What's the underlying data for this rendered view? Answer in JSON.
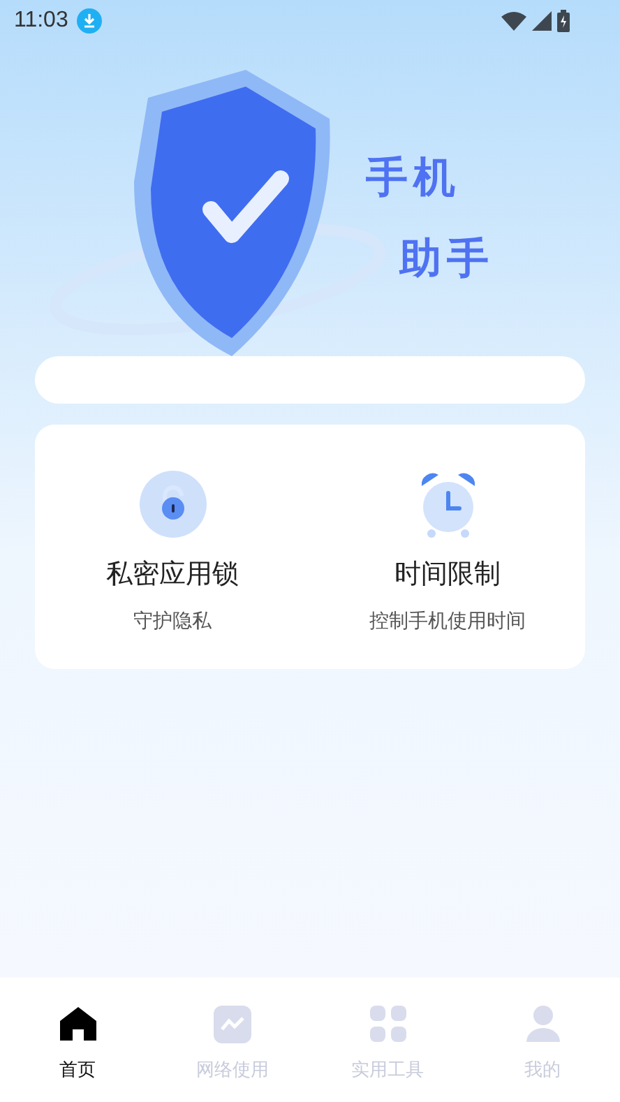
{
  "status_bar": {
    "time": "11:03"
  },
  "banner": {
    "title_line_1": "手机",
    "title_line_2": "助手"
  },
  "features": [
    {
      "kind": "lock",
      "title": "私密应用锁",
      "subtitle": "守护隐私"
    },
    {
      "kind": "clock",
      "title": "时间限制",
      "subtitle": "控制手机使用时间"
    }
  ],
  "nav": [
    {
      "kind": "home",
      "label": "首页",
      "selected": true
    },
    {
      "kind": "network",
      "label": "网络使用",
      "selected": false
    },
    {
      "kind": "tools",
      "label": "实用工具",
      "selected": false
    },
    {
      "kind": "mine",
      "label": "我的",
      "selected": false
    }
  ]
}
